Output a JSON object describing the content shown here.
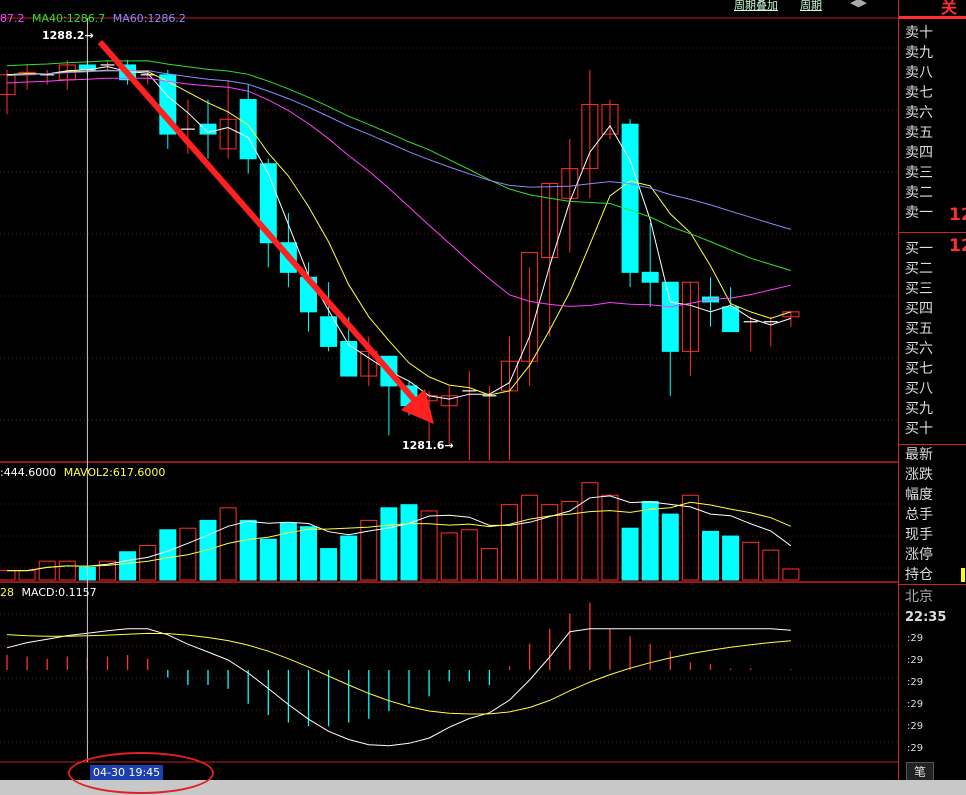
{
  "legends": {
    "ma": [
      {
        "text": "87.2",
        "color": "#ff40ff"
      },
      {
        "text": "MA40:1286.7",
        "color": "#30e030"
      },
      {
        "text": "MA60:1286.2",
        "color": "#8a8aff"
      }
    ],
    "vol": [
      {
        "text": ":444.6000",
        "color": "#ffffff"
      },
      {
        "text": "MAVOL2:617.6000",
        "color": "#ffff40"
      }
    ],
    "macd": [
      {
        "text": "28",
        "color": "#ffff40"
      },
      {
        "text": "MACD:0.1157",
        "color": "#ffffff"
      }
    ]
  },
  "annotations": {
    "high": "1288.2",
    "low": "1281.6"
  },
  "top_links": [
    "周期叠加",
    "周期"
  ],
  "sidebar": {
    "top_char": "关",
    "asks": [
      "卖十",
      "卖九",
      "卖八",
      "卖七",
      "卖六",
      "卖五",
      "卖四",
      "卖三",
      "卖二",
      "卖一"
    ],
    "bids": [
      "买一",
      "买二",
      "买三",
      "买四",
      "买五",
      "买六",
      "买七",
      "买八",
      "买九",
      "买十"
    ],
    "ask1_price": "12",
    "bid1_price": "12",
    "stats": [
      "最新",
      "涨跌",
      "幅度",
      "总手",
      "现手",
      "涨停",
      "持仓"
    ],
    "city": "北京",
    "time": "22:35",
    "ticks": [
      ":29",
      ":29",
      ":29",
      ":29",
      ":29",
      ":29"
    ],
    "tab": "笔"
  },
  "crosshair_time": "04-30 19:45",
  "colors": {
    "up": "#ff3030",
    "down": "#00ffff",
    "ma5": "#ffffff",
    "ma10": "#ffff40",
    "ma20": "#ff40ff",
    "ma40": "#30e030",
    "ma60": "#8a8aff",
    "arrow": "#ff2020"
  },
  "chart_data": {
    "type": "candlestick",
    "candles": [
      {
        "o": 1287.5,
        "h": 1288.0,
        "l": 1287.1,
        "c": 1287.9
      },
      {
        "o": 1287.9,
        "h": 1288.1,
        "l": 1287.6,
        "c": 1287.95
      },
      {
        "o": 1287.9,
        "h": 1288.0,
        "l": 1287.7,
        "c": 1287.9
      },
      {
        "o": 1287.8,
        "h": 1288.2,
        "l": 1287.6,
        "c": 1288.1
      },
      {
        "o": 1288.1,
        "h": 1288.2,
        "l": 1287.9,
        "c": 1288.0
      },
      {
        "o": 1288.1,
        "h": 1288.2,
        "l": 1288.0,
        "c": 1288.1
      },
      {
        "o": 1288.1,
        "h": 1288.2,
        "l": 1287.7,
        "c": 1287.8
      },
      {
        "o": 1287.9,
        "h": 1288.0,
        "l": 1287.7,
        "c": 1287.9
      },
      {
        "o": 1287.9,
        "h": 1288.0,
        "l": 1286.4,
        "c": 1286.7
      },
      {
        "o": 1286.8,
        "h": 1287.4,
        "l": 1286.3,
        "c": 1286.8
      },
      {
        "o": 1286.9,
        "h": 1287.4,
        "l": 1286.2,
        "c": 1286.7
      },
      {
        "o": 1286.4,
        "h": 1287.8,
        "l": 1286.2,
        "c": 1287.0
      },
      {
        "o": 1287.4,
        "h": 1287.7,
        "l": 1285.9,
        "c": 1286.2
      },
      {
        "o": 1286.1,
        "h": 1286.2,
        "l": 1284.0,
        "c": 1284.5
      },
      {
        "o": 1284.5,
        "h": 1285.1,
        "l": 1283.6,
        "c": 1283.9
      },
      {
        "o": 1283.8,
        "h": 1284.1,
        "l": 1282.7,
        "c": 1283.1
      },
      {
        "o": 1283.0,
        "h": 1283.7,
        "l": 1282.3,
        "c": 1282.4
      },
      {
        "o": 1282.5,
        "h": 1283.0,
        "l": 1281.9,
        "c": 1281.8
      },
      {
        "o": 1281.8,
        "h": 1282.6,
        "l": 1281.6,
        "c": 1282.3
      },
      {
        "o": 1282.2,
        "h": 1282.2,
        "l": 1280.6,
        "c": 1281.6
      },
      {
        "o": 1281.6,
        "h": 1281.7,
        "l": 1281.0,
        "c": 1281.2
      },
      {
        "o": 1281.3,
        "h": 1281.5,
        "l": 1280.3,
        "c": 1281.4
      },
      {
        "o": 1281.2,
        "h": 1281.6,
        "l": 1280.4,
        "c": 1281.4
      },
      {
        "o": 1281.5,
        "h": 1281.9,
        "l": 1280.1,
        "c": 1281.5
      },
      {
        "o": 1281.4,
        "h": 1281.6,
        "l": 1280.1,
        "c": 1281.4
      },
      {
        "o": 1281.5,
        "h": 1282.6,
        "l": 1280.1,
        "c": 1282.1
      },
      {
        "o": 1282.1,
        "h": 1284.0,
        "l": 1281.6,
        "c": 1284.3
      },
      {
        "o": 1284.2,
        "h": 1285.7,
        "l": 1282.6,
        "c": 1285.7
      },
      {
        "o": 1285.4,
        "h": 1286.6,
        "l": 1284.3,
        "c": 1286.0
      },
      {
        "o": 1286.0,
        "h": 1288.0,
        "l": 1285.4,
        "c": 1287.3
      },
      {
        "o": 1286.7,
        "h": 1287.4,
        "l": 1286.6,
        "c": 1287.3
      },
      {
        "o": 1286.9,
        "h": 1287.0,
        "l": 1283.6,
        "c": 1283.9
      },
      {
        "o": 1283.9,
        "h": 1284.9,
        "l": 1283.2,
        "c": 1283.7
      },
      {
        "o": 1283.7,
        "h": 1283.7,
        "l": 1281.4,
        "c": 1282.3
      },
      {
        "o": 1282.3,
        "h": 1283.7,
        "l": 1281.8,
        "c": 1283.7
      },
      {
        "o": 1283.4,
        "h": 1283.8,
        "l": 1282.8,
        "c": 1283.3
      },
      {
        "o": 1283.2,
        "h": 1283.6,
        "l": 1282.7,
        "c": 1282.7
      },
      {
        "o": 1282.9,
        "h": 1283.0,
        "l": 1282.3,
        "c": 1282.9
      },
      {
        "o": 1282.9,
        "h": 1283.0,
        "l": 1282.4,
        "c": 1282.9
      },
      {
        "o": 1283.0,
        "h": 1283.1,
        "l": 1282.8,
        "c": 1283.1
      }
    ],
    "volume": [
      60,
      60,
      120,
      120,
      80,
      120,
      180,
      220,
      320,
      330,
      380,
      460,
      380,
      260,
      360,
      340,
      200,
      280,
      380,
      460,
      480,
      440,
      300,
      320,
      200,
      480,
      540,
      480,
      500,
      620,
      540,
      330,
      500,
      420,
      540,
      310,
      280,
      240,
      190,
      70
    ],
    "macd_hist": [
      0.2,
      0.18,
      0.15,
      0.18,
      0.16,
      0.18,
      0.2,
      0.15,
      -0.1,
      -0.2,
      -0.2,
      -0.25,
      -0.45,
      -0.6,
      -0.7,
      -0.75,
      -0.75,
      -0.7,
      -0.65,
      -0.55,
      -0.45,
      -0.35,
      -0.15,
      -0.15,
      -0.2,
      0.05,
      0.35,
      0.55,
      0.75,
      0.9,
      0.55,
      0.45,
      0.35,
      0.25,
      0.1,
      0.08,
      0.02,
      0.02,
      0.0,
      0.01
    ],
    "ylim_price": [
      1280.1,
      1288.2
    ]
  }
}
